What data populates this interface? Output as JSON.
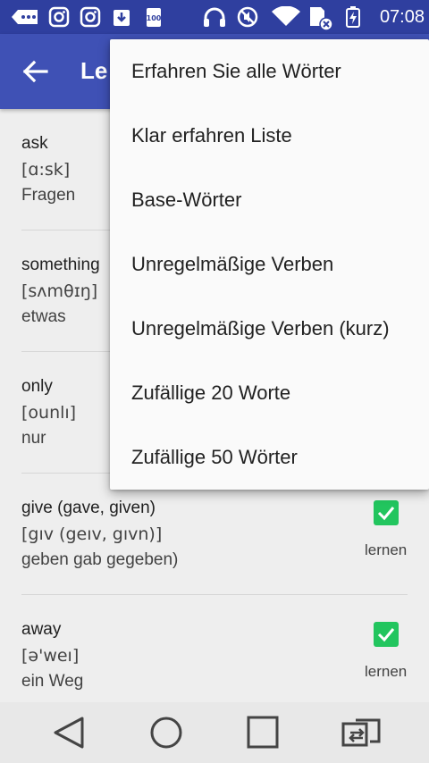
{
  "status_bar": {
    "time": "07:08"
  },
  "app_bar": {
    "title_visible": "Le"
  },
  "menu": {
    "items": [
      "Erfahren Sie alle Wörter",
      "Klar erfahren Liste",
      "Base-Wörter",
      "Unregelmäßige Verben",
      "Unregelmäßige Verben (kurz)",
      "Zufällige 20 Worte",
      "Zufällige 50 Wörter"
    ]
  },
  "words": [
    {
      "en": "ask",
      "ipa": "[ɑ:sk]",
      "de": "Fragen"
    },
    {
      "en": "something",
      "ipa": "[sʌmθɪŋ]",
      "de": "etwas"
    },
    {
      "en": "only",
      "ipa": "[ounlı]",
      "de": "nur"
    },
    {
      "en": "give (gave, given)",
      "ipa": "[gıv (geıv, gıvn)]",
      "de": "geben gab gegeben)",
      "learn_label": "lernen",
      "learn_checked": true
    },
    {
      "en": "away",
      "ipa": "[ə'weı]",
      "de": "ein Weg",
      "learn_label": "lernen",
      "learn_checked": true
    }
  ],
  "colors": {
    "status_bar": "#2f3f9f",
    "app_bar": "#3f51b5",
    "checkbox": "#22c55e",
    "background": "#eeeeee"
  }
}
